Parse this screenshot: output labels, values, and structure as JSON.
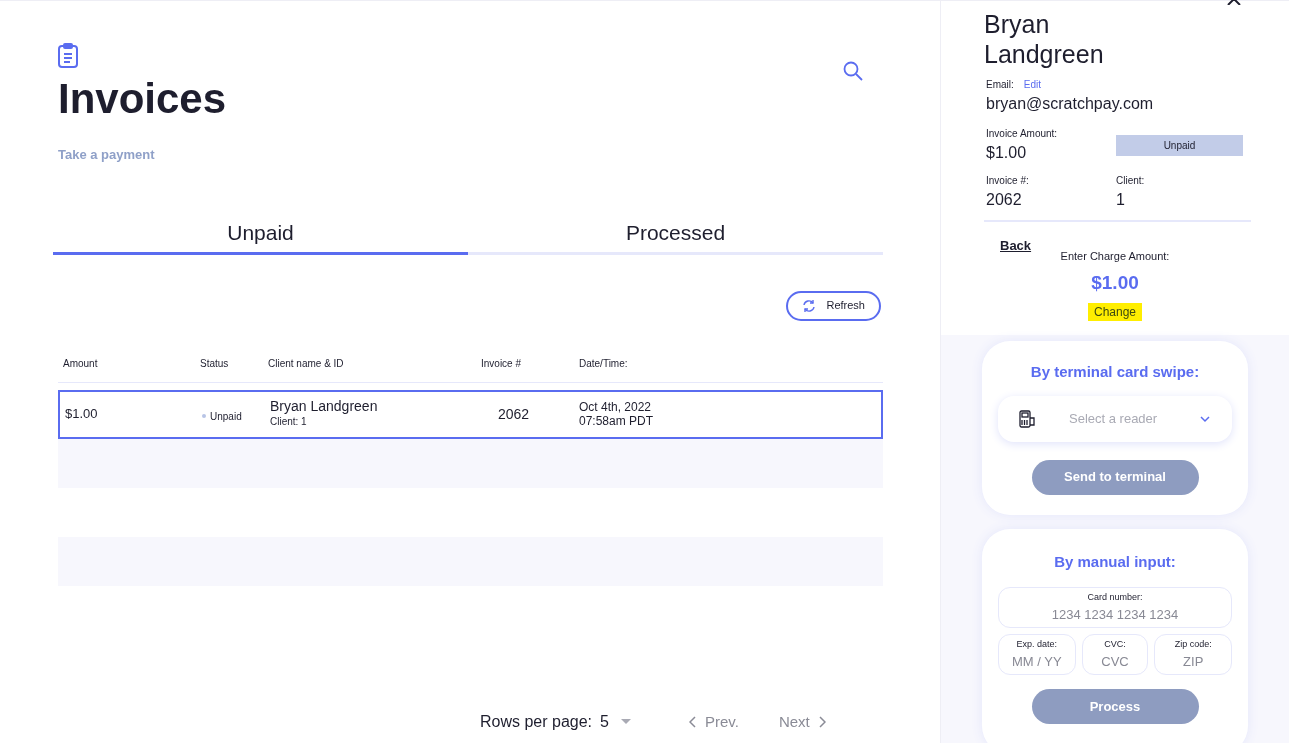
{
  "page": {
    "title": "Invoices",
    "action_link": "Take a payment"
  },
  "tabs": [
    {
      "label": "Unpaid",
      "selected": true
    },
    {
      "label": "Processed",
      "selected": false
    }
  ],
  "refresh_button": "Refresh",
  "table": {
    "columns": [
      "Amount",
      "Status",
      "Client name & ID",
      "Invoice #",
      "Date/Time:"
    ],
    "rows": [
      {
        "amount": "$1.00",
        "status": "Unpaid",
        "client_name": "Bryan Landgreen",
        "client_id": "Client: 1",
        "invoice": "2062",
        "date": "Oct 4th, 2022",
        "time": "07:58am PDT",
        "selected": true
      }
    ]
  },
  "pagination": {
    "rows_label": "Rows per page:",
    "rows_value": "5",
    "prev": "Prev.",
    "next": "Next",
    "prev_disabled": true,
    "next_disabled": true
  },
  "detail": {
    "name": "Bryan Landgreen",
    "email_label": "Email:",
    "edit_link": "Edit",
    "email": "bryan@scratchpay.com",
    "amount_label": "Invoice Amount:",
    "amount": "$1.00",
    "status": "Unpaid",
    "invoice_label": "Invoice #:",
    "invoice": "2062",
    "client_label": "Client:",
    "client": "1",
    "back_link": "Back",
    "charge_label": "Enter Charge Amount:",
    "charge_amount": "$1.00",
    "change_link": {
      "label": "Change",
      "highlighted": true
    }
  },
  "terminal": {
    "title": "By terminal card swipe:",
    "reader_placeholder": "Select a reader",
    "button": {
      "label": "Send to terminal",
      "disabled": true
    }
  },
  "manual": {
    "title": "By manual input:",
    "fields": [
      {
        "label": "Card number:",
        "placeholder": "1234 1234 1234 1234"
      },
      {
        "label": "Exp. date:",
        "placeholder": "MM / YY"
      },
      {
        "label": "CVC:",
        "placeholder": "CVC"
      },
      {
        "label": "Zip code:",
        "placeholder": "ZIP"
      }
    ],
    "button": {
      "label": "Process",
      "disabled": true
    }
  }
}
